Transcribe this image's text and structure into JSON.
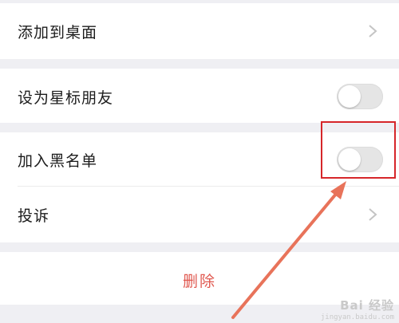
{
  "rows": {
    "add_to_desktop": {
      "label": "添加到桌面",
      "icon": "chevron-right-icon"
    },
    "star_friend": {
      "label": "设为星标朋友",
      "toggle_on": false
    },
    "blacklist": {
      "label": "加入黑名单",
      "toggle_on": false
    },
    "complain": {
      "label": "投诉",
      "icon": "chevron-right-icon"
    }
  },
  "actions": {
    "delete_label": "删除"
  },
  "annotation": {
    "highlight_color": "#d6262a",
    "arrow_color": "#e8735a"
  },
  "colors": {
    "delete_text": "#e0584f",
    "section_gap": "#efeff3",
    "chevron": "#c4c4c4"
  },
  "watermark": {
    "text": "Bai 经验",
    "subtext": "jingyan.baidu.com"
  }
}
